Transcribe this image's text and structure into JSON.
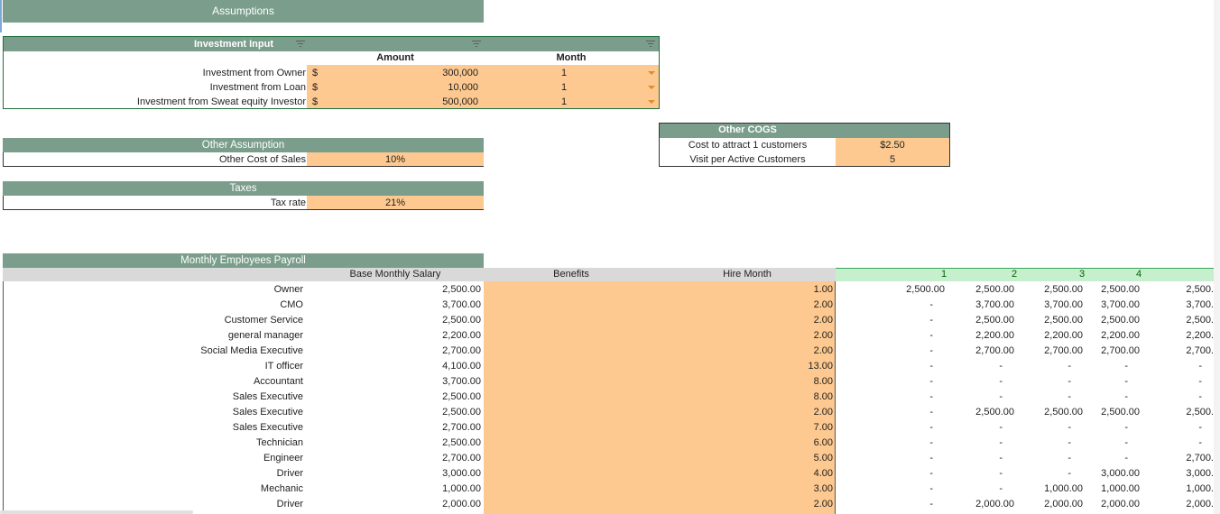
{
  "sheet": {
    "assumptions_title": "Assumptions",
    "investment": {
      "title": "Investment Input",
      "amount_header": "Amount",
      "month_header": "Month",
      "currency": "$",
      "rows": [
        {
          "label": "Investment from Owner",
          "amount": "300,000",
          "month": "1"
        },
        {
          "label": "Investment from Loan",
          "amount": "10,000",
          "month": "1"
        },
        {
          "label": "Investment from Sweat equity Investor",
          "amount": "500,000",
          "month": "1"
        }
      ]
    },
    "other_assumption": {
      "title": "Other Assumption",
      "label": "Other Cost of Sales",
      "value": "10%"
    },
    "taxes": {
      "title": "Taxes",
      "label": "Tax rate",
      "value": "21%"
    },
    "other_cogs": {
      "title": "Other COGS",
      "rows": [
        {
          "label": "Cost to attract 1 customers",
          "value": "$2.50"
        },
        {
          "label": "Visit per Active Customers",
          "value": "5"
        }
      ]
    },
    "payroll": {
      "title": "Monthly Employees Payroll",
      "headers": {
        "salary": "Base Monthly Salary",
        "benefits": "Benefits",
        "hire": "Hire Month"
      },
      "months": [
        "1",
        "2",
        "3",
        "4"
      ],
      "rows": [
        {
          "role": "Owner",
          "salary": "2,500.00",
          "hire": "1.00",
          "m": [
            "2,500.00",
            "2,500.00",
            "2,500.00",
            "2,500.00",
            "2,500."
          ]
        },
        {
          "role": "CMO",
          "salary": "3,700.00",
          "hire": "2.00",
          "m": [
            "-",
            "3,700.00",
            "3,700.00",
            "3,700.00",
            "3,700."
          ]
        },
        {
          "role": "Customer Service",
          "salary": "2,500.00",
          "hire": "2.00",
          "m": [
            "-",
            "2,500.00",
            "2,500.00",
            "2,500.00",
            "2,500."
          ]
        },
        {
          "role": "general manager",
          "salary": "2,200.00",
          "hire": "2.00",
          "m": [
            "-",
            "2,200.00",
            "2,200.00",
            "2,200.00",
            "2,200."
          ]
        },
        {
          "role": "Social Media Executive",
          "salary": "2,700.00",
          "hire": "2.00",
          "m": [
            "-",
            "2,700.00",
            "2,700.00",
            "2,700.00",
            "2,700."
          ]
        },
        {
          "role": "IT officer",
          "salary": "4,100.00",
          "hire": "13.00",
          "m": [
            "-",
            "-",
            "-",
            "-",
            "-"
          ]
        },
        {
          "role": "Accountant",
          "salary": "3,700.00",
          "hire": "8.00",
          "m": [
            "-",
            "-",
            "-",
            "-",
            "-"
          ]
        },
        {
          "role": "Sales Executive",
          "salary": "2,500.00",
          "hire": "8.00",
          "m": [
            "-",
            "-",
            "-",
            "-",
            "-"
          ]
        },
        {
          "role": "Sales Executive",
          "salary": "2,500.00",
          "hire": "2.00",
          "m": [
            "-",
            "2,500.00",
            "2,500.00",
            "2,500.00",
            "2,500."
          ]
        },
        {
          "role": "Sales Executive",
          "salary": "2,700.00",
          "hire": "7.00",
          "m": [
            "-",
            "-",
            "-",
            "-",
            "-"
          ]
        },
        {
          "role": "Technician",
          "salary": "2,500.00",
          "hire": "6.00",
          "m": [
            "-",
            "-",
            "-",
            "-",
            "-"
          ]
        },
        {
          "role": "Engineer",
          "salary": "2,700.00",
          "hire": "5.00",
          "m": [
            "-",
            "-",
            "-",
            "-",
            "2,700."
          ]
        },
        {
          "role": "Driver",
          "salary": "3,000.00",
          "hire": "4.00",
          "m": [
            "-",
            "-",
            "-",
            "3,000.00",
            "3,000."
          ]
        },
        {
          "role": "Mechanic",
          "salary": "1,000.00",
          "hire": "3.00",
          "m": [
            "-",
            "-",
            "1,000.00",
            "1,000.00",
            "1,000."
          ]
        },
        {
          "role": "Driver",
          "salary": "2,000.00",
          "hire": "2.00",
          "m": [
            "-",
            "2,000.00",
            "2,000.00",
            "2,000.00",
            "2,000."
          ]
        }
      ]
    }
  }
}
